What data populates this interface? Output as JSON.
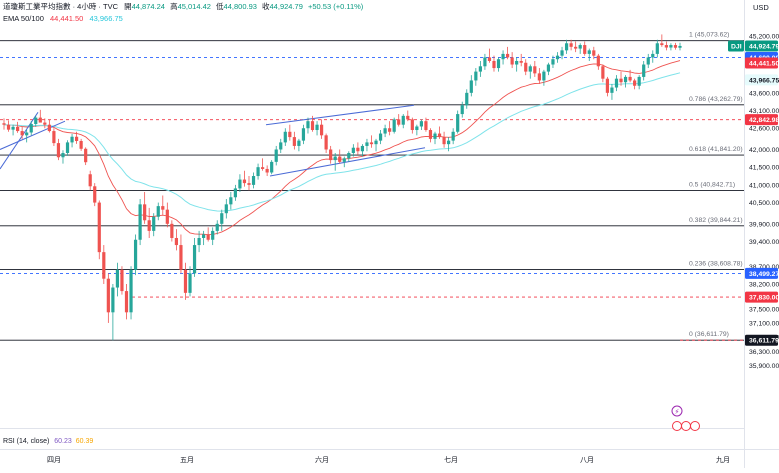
{
  "header": {
    "line1": {
      "name": "道瓊斯工業平均指數 · 4小時 · TVC",
      "open_label": "開",
      "open": "44,874.24",
      "high_label": "高",
      "high": "45,014.42",
      "low_label": "低",
      "low": "44,800.93",
      "close_label": "收",
      "close": "44,924.79",
      "change": "+50.53 (+0.11%)"
    },
    "line2": {
      "label": "EMA 50/100",
      "ema50": "44,441.50",
      "ema100": "43,966.75"
    },
    "currency": "USD"
  },
  "rsi": {
    "label": "RSI (14, close)",
    "v1": "60.23",
    "v2": "60.39"
  },
  "colors": {
    "up": "#26a69a",
    "down": "#ef5350",
    "ema50": "#ef5350",
    "ema100": "#7fe3ea",
    "trend": "#4b6bd6",
    "fib": "#6a6d78",
    "red_dash": "#f23645",
    "blue_dash": "#2962ff"
  },
  "chart_data": {
    "type": "candlestick",
    "symbol": "DJI",
    "interval": "4H",
    "ylim": [
      35800,
      45500
    ],
    "x_ticks": [
      "四月",
      "五月",
      "六月",
      "七月",
      "八月",
      "九月"
    ],
    "y_ticks": [
      "45,200.00",
      "44,600.00",
      "43,600.00",
      "43,100.00",
      "42,600.00",
      "42,000.00",
      "41,500.00",
      "41,000.00",
      "40,500.00",
      "39,900.00",
      "39,400.00",
      "38,700.00",
      "38,200.00",
      "37,500.00",
      "37,100.00",
      "36,700.00",
      "36,300.00",
      "35,900.00"
    ],
    "fib_levels": [
      {
        "label": "1 (45,073.62)",
        "value": 45073.62
      },
      {
        "label": "0.786 (43,262.79)",
        "value": 43262.79
      },
      {
        "label": "0.618 (41,841.20)",
        "value": 41841.2
      },
      {
        "label": "0.5 (40,842.71)",
        "value": 40842.71
      },
      {
        "label": "0.382 (39,844.21)",
        "value": 39844.21
      },
      {
        "label": "0.236 (38,608.78)",
        "value": 38608.78
      },
      {
        "label": "0 (36,611.79)",
        "value": 36611.79
      }
    ],
    "price_tags": [
      {
        "text": "DJI",
        "value": "44,924.79",
        "bg": "#089981",
        "fg": "#ffffff",
        "y": 44924.79
      },
      {
        "text": "",
        "value": "44,600.00",
        "bg": "#2962ff",
        "fg": "#ffffff",
        "y": 44600
      },
      {
        "text": "",
        "value": "44,441.50",
        "bg": "#f23645",
        "fg": "#ffffff",
        "y": 44441.5
      },
      {
        "text": "",
        "value": "43,966.75",
        "bg": "#e6fbfc",
        "fg": "#131722",
        "y": 43966.75
      },
      {
        "text": "",
        "value": "42,842.98",
        "bg": "#f23645",
        "fg": "#ffffff",
        "y": 42842.98
      },
      {
        "text": "",
        "value": "38,499.27",
        "bg": "#2962ff",
        "fg": "#ffffff",
        "y": 38499.27
      },
      {
        "text": "",
        "value": "37,830.00",
        "bg": "#f23645",
        "fg": "#ffffff",
        "y": 37830
      },
      {
        "text": "",
        "value": "36,611.79",
        "bg": "#131722",
        "fg": "#ffffff",
        "y": 36611.79
      }
    ],
    "dashed_lines": [
      {
        "value": 44600,
        "color": "blue",
        "from": "start"
      },
      {
        "value": 42842.98,
        "color": "red",
        "from": "start"
      },
      {
        "value": 38499.27,
        "color": "blue",
        "from": "start"
      },
      {
        "value": 37830,
        "color": "red",
        "from": "mid"
      },
      {
        "value": 36611.79,
        "color": "red",
        "from": "end"
      }
    ],
    "candles": [
      [
        42740,
        42880,
        42560,
        42700
      ],
      [
        42700,
        42820,
        42500,
        42560
      ],
      [
        42560,
        42700,
        42400,
        42640
      ],
      [
        42640,
        42780,
        42470,
        42520
      ],
      [
        42520,
        42640,
        42300,
        42400
      ],
      [
        42400,
        42560,
        42200,
        42480
      ],
      [
        42480,
        42800,
        42400,
        42720
      ],
      [
        42720,
        42960,
        42640,
        42900
      ],
      [
        42900,
        43120,
        42780,
        42760
      ],
      [
        42760,
        42880,
        42600,
        42700
      ],
      [
        42700,
        42840,
        42480,
        42520
      ],
      [
        42520,
        42600,
        42100,
        42180
      ],
      [
        42180,
        42300,
        41700,
        41780
      ],
      [
        41780,
        41980,
        41600,
        41900
      ],
      [
        41900,
        42260,
        41820,
        42200
      ],
      [
        42200,
        42440,
        42060,
        42360
      ],
      [
        42360,
        42500,
        42160,
        42240
      ],
      [
        42240,
        42300,
        41960,
        42020
      ],
      [
        42020,
        42060,
        41560,
        41640
      ],
      [
        41300,
        41400,
        40850,
        40960
      ],
      [
        40960,
        41050,
        40400,
        40500
      ],
      [
        40500,
        40560,
        38900,
        39100
      ],
      [
        39100,
        39300,
        38200,
        38350
      ],
      [
        38350,
        38500,
        37100,
        37400
      ],
      [
        37400,
        38200,
        36611,
        38100
      ],
      [
        38100,
        38800,
        37850,
        38600
      ],
      [
        38600,
        38700,
        37900,
        38000
      ],
      [
        38000,
        38200,
        37200,
        37400
      ],
      [
        37400,
        38700,
        37200,
        38600
      ],
      [
        38600,
        39600,
        38450,
        39450
      ],
      [
        39450,
        40600,
        39300,
        40450
      ],
      [
        40450,
        40800,
        39900,
        40000
      ],
      [
        40000,
        40350,
        39500,
        39700
      ],
      [
        39700,
        40200,
        39550,
        40100
      ],
      [
        40100,
        40500,
        40000,
        40400
      ],
      [
        40400,
        40700,
        40150,
        40300
      ],
      [
        40300,
        40500,
        39800,
        39900
      ],
      [
        39900,
        40000,
        39400,
        39500
      ],
      [
        39500,
        39750,
        39150,
        39300
      ],
      [
        39300,
        39600,
        38500,
        38600
      ],
      [
        38600,
        38800,
        37750,
        37950
      ],
      [
        37950,
        38700,
        37850,
        38500
      ],
      [
        38500,
        39500,
        38400,
        39300
      ],
      [
        39300,
        39700,
        39100,
        39500
      ],
      [
        39500,
        39700,
        39300,
        39600
      ],
      [
        39600,
        39800,
        39400,
        39450
      ],
      [
        39450,
        39800,
        39300,
        39700
      ],
      [
        39700,
        40000,
        39600,
        39900
      ],
      [
        39900,
        40300,
        39700,
        40200
      ],
      [
        40200,
        40600,
        40050,
        40450
      ],
      [
        40450,
        40800,
        40300,
        40650
      ],
      [
        40650,
        41000,
        40550,
        40900
      ],
      [
        40900,
        41300,
        40800,
        41150
      ],
      [
        41150,
        41400,
        40950,
        41050
      ],
      [
        41050,
        41250,
        40850,
        41000
      ],
      [
        41000,
        41350,
        40900,
        41250
      ],
      [
        41250,
        41600,
        41150,
        41500
      ],
      [
        41500,
        41750,
        41400,
        41450
      ],
      [
        41450,
        41550,
        41250,
        41350
      ],
      [
        41350,
        41700,
        41300,
        41650
      ],
      [
        41650,
        42100,
        41550,
        42000
      ],
      [
        42000,
        42300,
        41900,
        42200
      ],
      [
        42200,
        42600,
        42100,
        42500
      ],
      [
        42500,
        42700,
        42250,
        42350
      ],
      [
        42350,
        42500,
        42000,
        42100
      ],
      [
        42100,
        42300,
        41950,
        42250
      ],
      [
        42250,
        42700,
        42150,
        42600
      ],
      [
        42600,
        42900,
        42450,
        42800
      ],
      [
        42800,
        42950,
        42500,
        42550
      ],
      [
        42550,
        42800,
        42400,
        42700
      ],
      [
        42700,
        42850,
        42300,
        42400
      ],
      [
        42400,
        42450,
        41900,
        42000
      ],
      [
        42000,
        42100,
        41600,
        41700
      ],
      [
        41700,
        41900,
        41400,
        41800
      ],
      [
        41800,
        42000,
        41600,
        41650
      ],
      [
        41650,
        41800,
        41500,
        41750
      ],
      [
        41750,
        41950,
        41650,
        41900
      ],
      [
        41900,
        42150,
        41800,
        42050
      ],
      [
        42050,
        42200,
        41850,
        41950
      ],
      [
        41950,
        42150,
        41800,
        42100
      ],
      [
        42100,
        42300,
        41950,
        42200
      ],
      [
        42200,
        42400,
        42050,
        42150
      ],
      [
        42150,
        42300,
        41950,
        42250
      ],
      [
        42250,
        42550,
        42150,
        42450
      ],
      [
        42450,
        42700,
        42350,
        42600
      ],
      [
        42600,
        42800,
        42400,
        42500
      ],
      [
        42500,
        42900,
        42450,
        42850
      ],
      [
        42850,
        43000,
        42650,
        42700
      ],
      [
        42700,
        43000,
        42600,
        42950
      ],
      [
        42950,
        43100,
        42800,
        42850
      ],
      [
        42850,
        42900,
        42450,
        42550
      ],
      [
        42550,
        42700,
        42400,
        42650
      ],
      [
        42650,
        42850,
        42550,
        42800
      ],
      [
        42800,
        42900,
        42500,
        42550
      ],
      [
        42550,
        42600,
        42200,
        42300
      ],
      [
        42300,
        42500,
        42150,
        42450
      ],
      [
        42450,
        42650,
        42300,
        42350
      ],
      [
        42350,
        42500,
        42050,
        42150
      ],
      [
        42150,
        42350,
        41950,
        42250
      ],
      [
        42250,
        42600,
        42150,
        42500
      ],
      [
        42500,
        43100,
        42450,
        43000
      ],
      [
        43000,
        43350,
        42900,
        43250
      ],
      [
        43250,
        43700,
        43150,
        43600
      ],
      [
        43600,
        44100,
        43500,
        43950
      ],
      [
        43950,
        44300,
        43800,
        44200
      ],
      [
        44200,
        44500,
        44050,
        44350
      ],
      [
        44350,
        44700,
        44250,
        44600
      ],
      [
        44600,
        44850,
        44450,
        44500
      ],
      [
        44500,
        44650,
        44200,
        44300
      ],
      [
        44300,
        44600,
        44200,
        44550
      ],
      [
        44550,
        44800,
        44400,
        44700
      ],
      [
        44700,
        44900,
        44550,
        44600
      ],
      [
        44600,
        44750,
        44300,
        44400
      ],
      [
        44400,
        44600,
        44200,
        44500
      ],
      [
        44500,
        44700,
        44350,
        44450
      ],
      [
        44450,
        44550,
        44100,
        44200
      ],
      [
        44200,
        44400,
        44000,
        44350
      ],
      [
        44350,
        44500,
        44050,
        44150
      ],
      [
        44150,
        44300,
        43850,
        43950
      ],
      [
        43950,
        44250,
        43800,
        44200
      ],
      [
        44200,
        44450,
        44100,
        44400
      ],
      [
        44400,
        44650,
        44300,
        44550
      ],
      [
        44550,
        44750,
        44450,
        44650
      ],
      [
        44650,
        44900,
        44550,
        44800
      ],
      [
        44800,
        45100,
        44700,
        45000
      ],
      [
        45000,
        45100,
        44800,
        44900
      ],
      [
        44900,
        45050,
        44750,
        44850
      ],
      [
        44850,
        45000,
        44700,
        44950
      ],
      [
        44950,
        45050,
        44650,
        44700
      ],
      [
        44700,
        44850,
        44500,
        44800
      ],
      [
        44800,
        44900,
        44550,
        44650
      ],
      [
        44650,
        44700,
        44250,
        44350
      ],
      [
        44350,
        44400,
        43900,
        44000
      ],
      [
        44000,
        44050,
        43500,
        43600
      ],
      [
        43600,
        43850,
        43400,
        43750
      ],
      [
        43750,
        44100,
        43650,
        44000
      ],
      [
        44000,
        44200,
        43800,
        43900
      ],
      [
        43900,
        44100,
        43750,
        44050
      ],
      [
        44050,
        44250,
        43900,
        43950
      ],
      [
        43950,
        44000,
        43700,
        43800
      ],
      [
        43800,
        44100,
        43700,
        44050
      ],
      [
        44050,
        44500,
        43950,
        44400
      ],
      [
        44400,
        44700,
        44300,
        44600
      ],
      [
        44600,
        44800,
        44450,
        44700
      ],
      [
        44700,
        45100,
        44600,
        45000
      ],
      [
        45000,
        45250,
        44900,
        44950
      ],
      [
        44950,
        45050,
        44800,
        44880
      ],
      [
        44880,
        45000,
        44800,
        44950
      ],
      [
        44950,
        45010,
        44820,
        44874
      ],
      [
        44874,
        45014,
        44801,
        44925
      ]
    ]
  }
}
